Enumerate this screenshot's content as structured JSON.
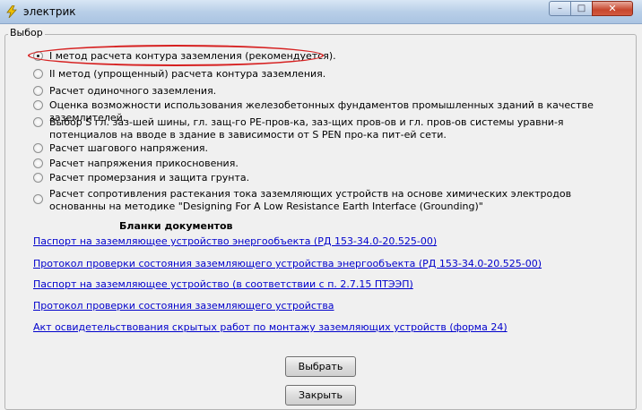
{
  "window": {
    "title": "электрик",
    "min_glyph": "–",
    "max_glyph": "□",
    "close_glyph": "✕",
    "icon": "lightning-icon"
  },
  "group": {
    "label": "Выбор"
  },
  "options": [
    {
      "label": "I метод расчета контура заземления (рекомендуется).",
      "checked": true
    },
    {
      "label": "II метод (упрощенный) расчета контура заземления.",
      "checked": false
    },
    {
      "label": "Расчет одиночного заземления.",
      "checked": false
    },
    {
      "label": "Оценка возможности использования железобетонных фундаментов промышленных зданий в качестве заземлителей.",
      "checked": false
    },
    {
      "label": "Выбор S гл. заз-шей шины, гл. защ-го PE-пров-ка, заз-щих пров-ов  и гл. пров-ов системы уравни-я потенциалов на вводе в здание в зависимости от S PEN про-ка пит-ей сети.",
      "checked": false
    },
    {
      "label": "Расчет шагового напряжения.",
      "checked": false
    },
    {
      "label": "Расчет напряжения прикосновения.",
      "checked": false
    },
    {
      "label": "Расчет промерзания и защита грунта.",
      "checked": false
    },
    {
      "label": "Расчет сопротивления растекания тока заземляющих устройств на основе химических электродов основанны на методике \"Designing For A Low Resistance Earth Interface (Grounding)\"",
      "checked": false
    }
  ],
  "blanks": {
    "title": "Бланки документов",
    "links": [
      "Паспорт на заземляющее устройство энергообъекта (РД 153-34.0-20.525-00)",
      "Протокол проверки состояния заземляющего устройства энергообъекта (РД 153-34.0-20.525-00)",
      "Паспорт на заземляющее устройство (в соответствии с п. 2.7.15 ПТЭЭП)",
      "Протокол проверки состояния заземляющего устройства ",
      "Акт освидетельствования скрытых работ по монтажу заземляющих устройств (форма 24)"
    ]
  },
  "buttons": {
    "select": "Выбрать",
    "close": "Закрыть"
  },
  "colors": {
    "link": "#0000cc",
    "highlight": "#d62020"
  }
}
